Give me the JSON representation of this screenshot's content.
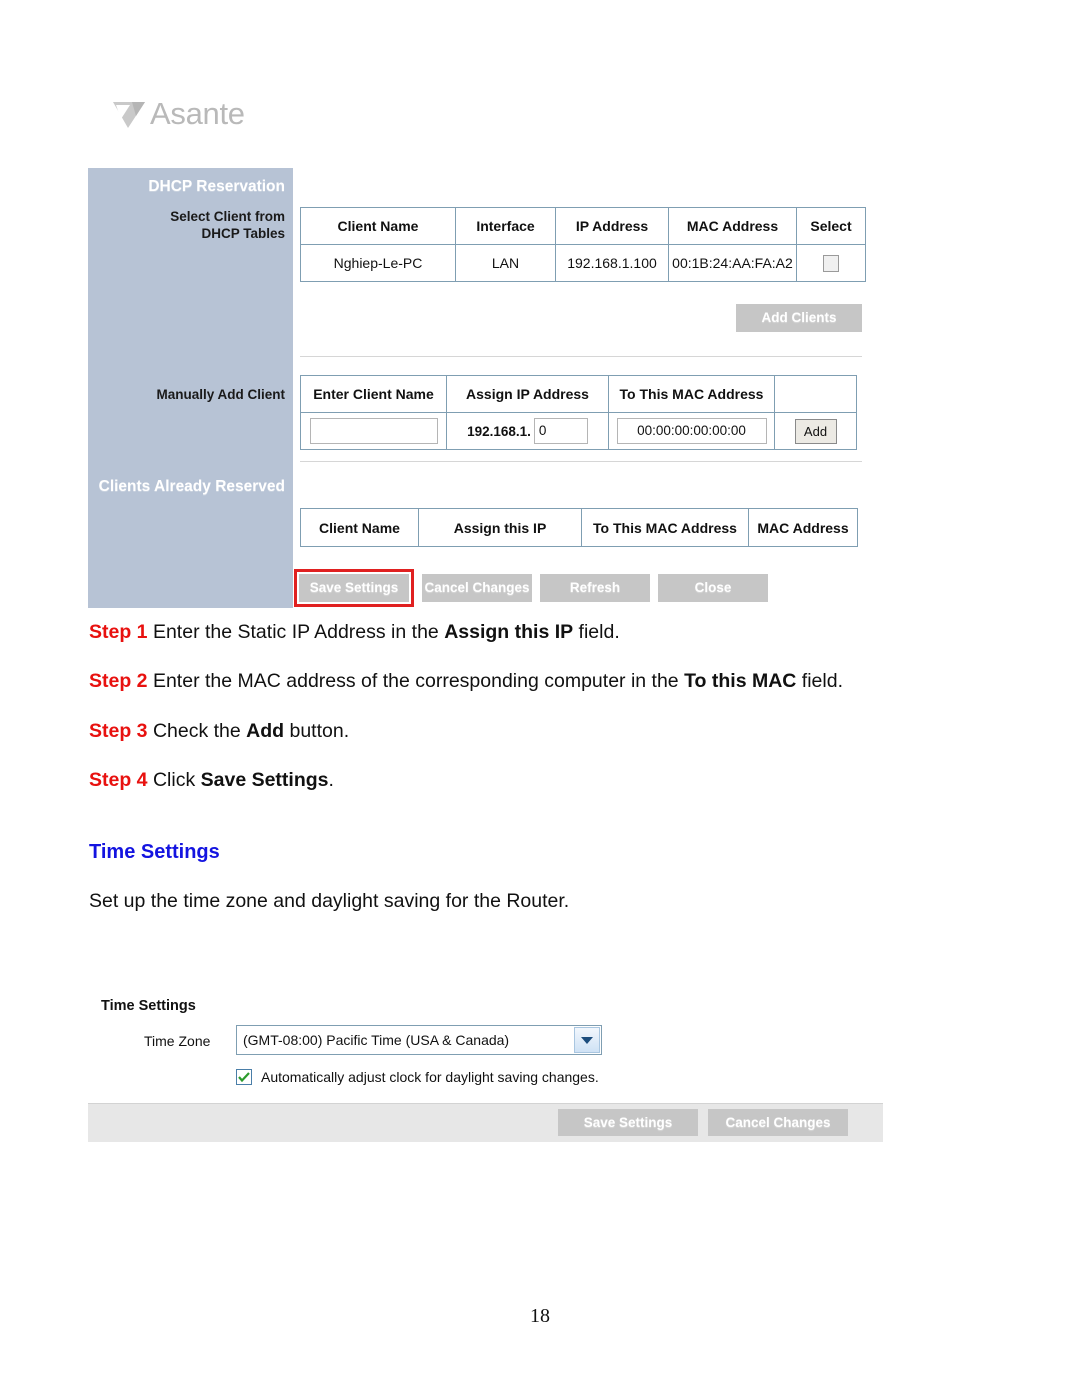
{
  "brand": {
    "logo_text": "Asante",
    "logo_icon": "asante-arrow-mark"
  },
  "dhcp_panel": {
    "sidebar": {
      "section_title": "DHCP Reservation",
      "select_client_label_line1": "Select Client from",
      "select_client_label_line2": "DHCP Tables",
      "manually_add_label": "Manually Add Client",
      "reserved_title": "Clients Already Reserved"
    },
    "dhcp_table": {
      "headers": [
        "Client Name",
        "Interface",
        "IP Address",
        "MAC Address",
        "Select"
      ],
      "rows": [
        {
          "client_name": "Nghiep-Le-PC",
          "interface": "LAN",
          "ip_address": "192.168.1.100",
          "mac_address": "00:1B:24:AA:FA:A2",
          "selected": false
        }
      ]
    },
    "add_clients_button": "Add Clients",
    "manual_table": {
      "headers": [
        "Enter Client Name",
        "Assign IP Address",
        "To This MAC Address",
        ""
      ],
      "client_name_value": "",
      "client_name_placeholder": "",
      "ip_prefix": "192.168.1.",
      "ip_octet_value": "0",
      "mac_value": "00:00:00:00:00:00",
      "add_button": "Add"
    },
    "reserved_table": {
      "headers": [
        "Client Name",
        "Assign this IP",
        "To This MAC Address",
        "MAC Address"
      ]
    },
    "buttons": {
      "save": "Save Settings",
      "cancel": "Cancel Changes",
      "refresh": "Refresh",
      "close": "Close"
    },
    "highlight_color": "#e02020"
  },
  "steps": [
    {
      "tag": "Step 1",
      "text_before": "Enter the Static IP Address in the ",
      "bold": "Assign this IP",
      "text_after": " field."
    },
    {
      "tag": "Step 2",
      "text_before": "Enter the MAC address of the corresponding computer in the ",
      "bold": "To this MAC",
      "text_after": " field."
    },
    {
      "tag": "Step 3",
      "text_before": "Check the ",
      "bold": "Add",
      "text_after": " button."
    },
    {
      "tag": "Step 4",
      "text_before": "Click ",
      "bold": "Save Settings",
      "text_after": "."
    }
  ],
  "time_section": {
    "heading": "Time Settings",
    "description": "Set up the time zone and daylight saving for the Router."
  },
  "time_panel": {
    "title": "Time Settings",
    "time_zone_label": "Time Zone",
    "time_zone_value": "(GMT-08:00) Pacific Time (USA & Canada)",
    "daylight_label": "Automatically adjust clock for daylight saving changes.",
    "daylight_checked": true,
    "save_button": "Save Settings",
    "cancel_button": "Cancel Changes"
  },
  "footer": {
    "page_number": "18"
  }
}
